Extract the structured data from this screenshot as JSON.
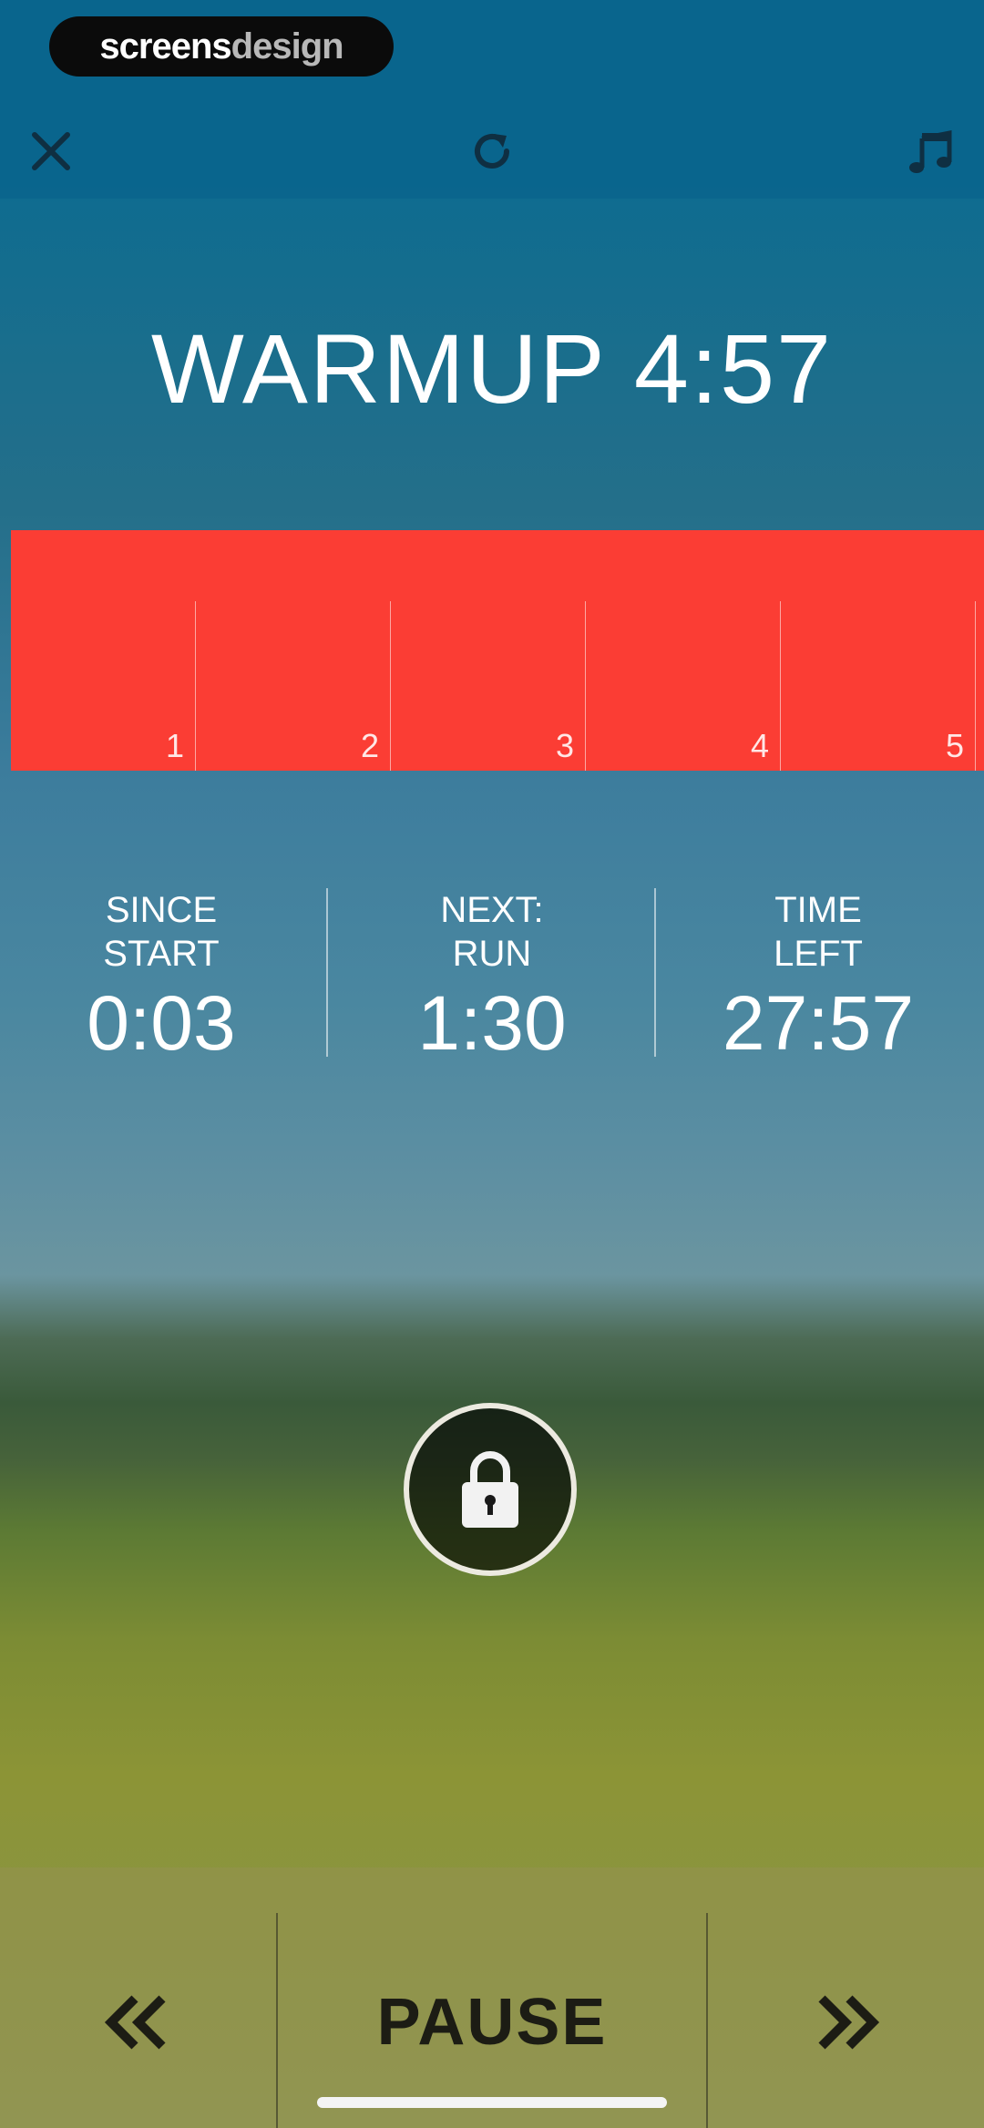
{
  "watermark": {
    "brand_strong": "screens",
    "brand_soft": "design"
  },
  "toolbar": {
    "close_icon": "close-icon",
    "restart_icon": "restart-icon",
    "music_icon": "music-icon"
  },
  "workout": {
    "title": "WARMUP 4:57",
    "progress": {
      "color": "#fb3d34",
      "fraction_elapsed": 0.0,
      "segments": [
        "1",
        "2",
        "3",
        "4",
        "5"
      ]
    }
  },
  "stats": [
    {
      "label": "SINCE\nSTART",
      "value": "0:03"
    },
    {
      "label": "NEXT:\nRUN",
      "value": "1:30"
    },
    {
      "label": "TIME\nLEFT",
      "value": "27:57"
    }
  ],
  "lock": {
    "icon": "lock-icon"
  },
  "controls": {
    "prev_icon": "double-chevron-left-icon",
    "pause_label": "PAUSE",
    "next_icon": "double-chevron-right-icon"
  }
}
